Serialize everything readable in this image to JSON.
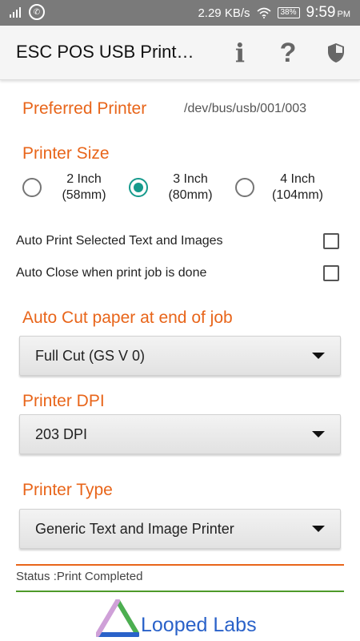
{
  "status_bar": {
    "net_speed": "2.29 KB/s",
    "battery": "38%",
    "time": "9:59",
    "ampm": "PM",
    "icons": [
      "signal-icon",
      "whatsapp-icon",
      "wifi-icon",
      "battery-icon"
    ]
  },
  "appbar": {
    "title": "ESC POS USB Print…",
    "icons": [
      "info-icon",
      "help-icon",
      "shield-icon"
    ]
  },
  "preferred_printer": {
    "label": "Preferred Printer",
    "value": "/dev/bus/usb/001/003"
  },
  "printer_size": {
    "label": "Printer Size",
    "options": [
      {
        "line1": "2 Inch",
        "line2": "(58mm)",
        "selected": false
      },
      {
        "line1": "3 Inch",
        "line2": "(80mm)",
        "selected": true
      },
      {
        "line1": "4 Inch",
        "line2": "(104mm)",
        "selected": false
      }
    ]
  },
  "checkboxes": [
    {
      "label": "Auto Print Selected Text and Images",
      "checked": false
    },
    {
      "label": "Auto Close when print job is done",
      "checked": false
    }
  ],
  "auto_cut": {
    "label": "Auto Cut paper at end of job",
    "selected": "Full Cut (GS V 0)"
  },
  "printer_dpi": {
    "label": "Printer DPI",
    "selected": "203 DPI"
  },
  "printer_type": {
    "label": "Printer Type",
    "selected": "Generic Text and Image Printer"
  },
  "status": {
    "text": "Status :Print Completed"
  },
  "footer": {
    "brand": "Looped Labs"
  },
  "colors": {
    "accent_orange": "#e8651a",
    "radio_teal": "#159a8c",
    "divider_green": "#4e9a2a",
    "brand_blue": "#2a62c9"
  }
}
